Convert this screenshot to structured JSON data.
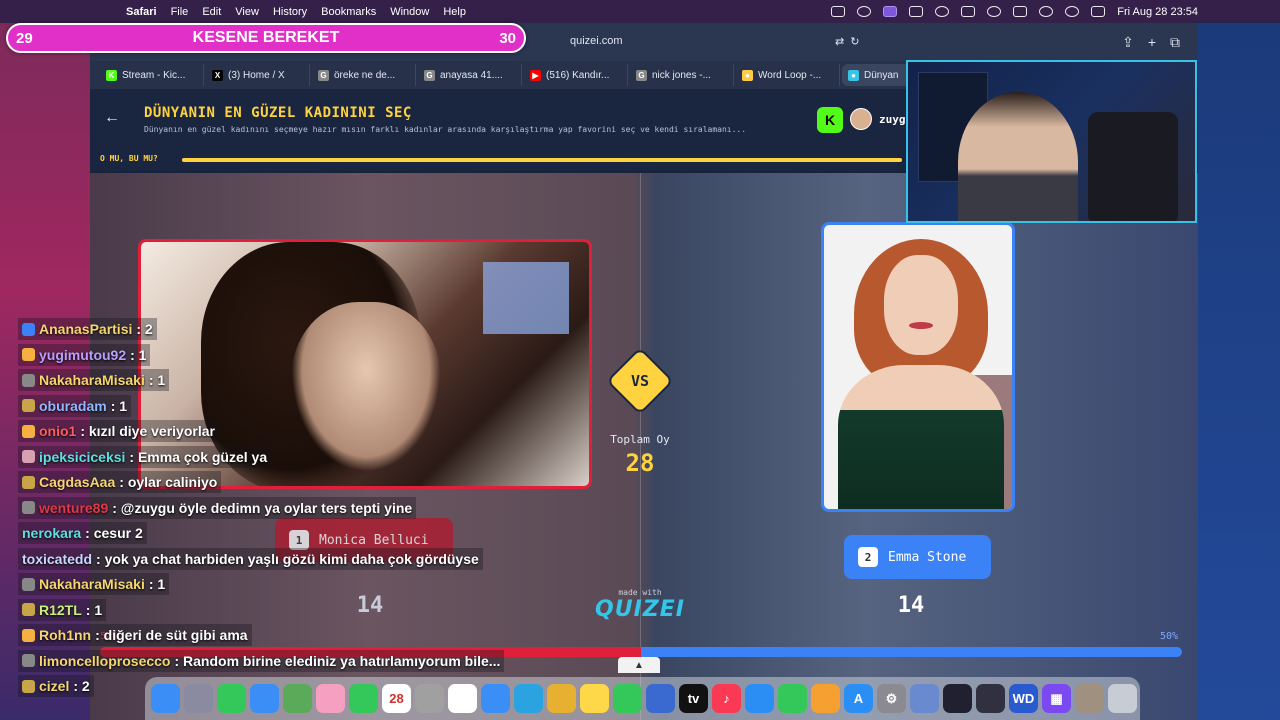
{
  "menubar": {
    "app": "Safari",
    "items": [
      "File",
      "Edit",
      "View",
      "History",
      "Bookmarks",
      "Window",
      "Help"
    ],
    "datetime": "Fri Aug 28  23:54"
  },
  "counter": {
    "left": "29",
    "title": "KESENE BEREKET",
    "right": "30",
    "color": "#e030c8"
  },
  "browser": {
    "url": "quizei.com",
    "tabs": [
      {
        "label": "Stream - Kic...",
        "icon": "kick-icon",
        "color": "#53fc18",
        "glyph": "K"
      },
      {
        "label": "(3) Home / X",
        "icon": "x-icon",
        "color": "#000000",
        "glyph": "X"
      },
      {
        "label": "öreke ne de...",
        "icon": "google-icon",
        "color": "#888888",
        "glyph": "G"
      },
      {
        "label": "anayasa 41....",
        "icon": "google-icon",
        "color": "#888888",
        "glyph": "G"
      },
      {
        "label": "(516) Kandır...",
        "icon": "youtube-icon",
        "color": "#ff0000",
        "glyph": "▶"
      },
      {
        "label": "nick jones -...",
        "icon": "google-icon",
        "color": "#888888",
        "glyph": "G"
      },
      {
        "label": "Word Loop -...",
        "icon": "rainbow-icon",
        "color": "#ffcc44",
        "glyph": "●"
      },
      {
        "label": "Dünyan",
        "icon": "quizei-icon",
        "color": "#33c6e8",
        "glyph": "●"
      }
    ]
  },
  "quiz": {
    "title": "DÜNYANIN EN GÜZEL KADININI SEÇ",
    "description": "Dünyanın en güzel kadınını seçmeye hazır mısın farklı kadınlar arasında karşılaştırma yap favorini seç ve kendi sıralamanı...",
    "user": "zuyg",
    "progress_label": "O MU, BU MU?",
    "progress": 1.0,
    "vs": "VS",
    "total_label": "Toplam Oy",
    "total_votes": "28",
    "made_with": "made with",
    "brand": "QUIZEI",
    "left": {
      "number": "1",
      "name": "Monica Belluci",
      "votes": "14",
      "percent": "50%"
    },
    "right": {
      "number": "2",
      "name": "Emma Stone",
      "votes": "14",
      "percent": "50%"
    },
    "colors": {
      "accent": "#ffd23f",
      "left": "#e0203a",
      "right": "#3b82f6"
    }
  },
  "chat": [
    {
      "user": "AnanasPartisi",
      "text": ": 2",
      "color": "#f5d76e",
      "badge": "#3b82f6"
    },
    {
      "user": "yugimutou92",
      "text": ": 1",
      "color": "#b8a0ff",
      "badge": "#f5b041"
    },
    {
      "user": "NakaharaMisaki",
      "text": ": 1",
      "color": "#f5d76e",
      "badge": "#888888"
    },
    {
      "user": "oburadam",
      "text": ": 1",
      "color": "#8fb8ff",
      "badge": "#c9a54a"
    },
    {
      "user": "onio1",
      "text": ": kızıl diye veriyorlar",
      "color": "#ff5c5c",
      "badge": "#f5b041"
    },
    {
      "user": "ipeksiciceksi",
      "text": ": Emma çok güzel ya",
      "color": "#5ce0e0",
      "badge": "#d8a0b0"
    },
    {
      "user": "CagdasAaa",
      "text": ": oylar caliniyo",
      "color": "#f5d76e",
      "badge": "#c9a54a"
    },
    {
      "user": "wenture89",
      "text": ": @zuygu öyle dedimn ya oylar ters tepti yine",
      "color": "#e03a4a",
      "badge": "#888888"
    },
    {
      "user": "nerokara",
      "text": ": cesur 2",
      "color": "#5ce0e0",
      "badge": ""
    },
    {
      "user": "toxicatedd",
      "text": ": yok ya chat harbiden yaşlı gözü kimi daha çok gördüyse",
      "color": "#c8d8ff",
      "badge": ""
    },
    {
      "user": "NakaharaMisaki",
      "text": ": 1",
      "color": "#f5d76e",
      "badge": "#888888"
    },
    {
      "user": "R12TL",
      "text": ": 1",
      "color": "#c8f07a",
      "badge": "#c9a54a"
    },
    {
      "user": "Roh1nn",
      "text": ": diğeri de süt gibi ama",
      "color": "#f5d76e",
      "badge": "#f5b041"
    },
    {
      "user": "limoncelloprosecco",
      "text": ": Random birine elediniz ya hatırlamıyorum bile...",
      "color": "#f5d76e",
      "badge": "#888888"
    },
    {
      "user": "cizel",
      "text": ": 2",
      "color": "#f5d76e",
      "badge": "#c9a54a"
    }
  ],
  "dock": {
    "apps": [
      {
        "name": "finder-icon",
        "color": "#3a8ef5",
        "glyph": ""
      },
      {
        "name": "launchpad-icon",
        "color": "#8a8aa0",
        "glyph": ""
      },
      {
        "name": "messages-icon",
        "color": "#34c759",
        "glyph": ""
      },
      {
        "name": "mail-icon",
        "color": "#3a8ef5",
        "glyph": ""
      },
      {
        "name": "maps-icon",
        "color": "#5aaa5a",
        "glyph": ""
      },
      {
        "name": "photos-icon",
        "color": "#f5a0c0",
        "glyph": ""
      },
      {
        "name": "facetime-icon",
        "color": "#34c759",
        "glyph": ""
      },
      {
        "name": "calendar-icon",
        "color": "#ffffff",
        "glyph": "28"
      },
      {
        "name": "contacts-icon",
        "color": "#a0a0a0",
        "glyph": ""
      },
      {
        "name": "reminders-icon",
        "color": "#ffffff",
        "glyph": ""
      },
      {
        "name": "safari-icon",
        "color": "#3a8ef5",
        "glyph": ""
      },
      {
        "name": "telegram-icon",
        "color": "#2aa3e0",
        "glyph": ""
      },
      {
        "name": "chrome-icon",
        "color": "#e8b030",
        "glyph": ""
      },
      {
        "name": "notes-icon",
        "color": "#ffd84a",
        "glyph": ""
      },
      {
        "name": "whatsapp-icon",
        "color": "#34c759",
        "glyph": ""
      },
      {
        "name": "freeform-icon",
        "color": "#3a6ad0",
        "glyph": ""
      },
      {
        "name": "tv-icon",
        "color": "#111111",
        "glyph": "tv"
      },
      {
        "name": "music-icon",
        "color": "#fa3a55",
        "glyph": "♪"
      },
      {
        "name": "keynote-icon",
        "color": "#2a8ef5",
        "glyph": ""
      },
      {
        "name": "numbers-icon",
        "color": "#34c759",
        "glyph": ""
      },
      {
        "name": "pages-icon",
        "color": "#f5a030",
        "glyph": ""
      },
      {
        "name": "appstore-icon",
        "color": "#2a8ef5",
        "glyph": "A"
      },
      {
        "name": "settings-icon",
        "color": "#8a8a90",
        "glyph": "⚙"
      },
      {
        "name": "preview-icon",
        "color": "#6a8ad0",
        "glyph": ""
      },
      {
        "name": "obs-icon",
        "color": "#202030",
        "glyph": ""
      },
      {
        "name": "webcam-icon",
        "color": "#303040",
        "glyph": ""
      },
      {
        "name": "wd-icon",
        "color": "#2a5ad0",
        "glyph": "WD"
      },
      {
        "name": "grid-icon",
        "color": "#7a4af0",
        "glyph": "▦"
      },
      {
        "name": "image-icon",
        "color": "#a09080",
        "glyph": ""
      },
      {
        "name": "trash-icon",
        "color": "#c8ccd4",
        "glyph": ""
      }
    ]
  }
}
